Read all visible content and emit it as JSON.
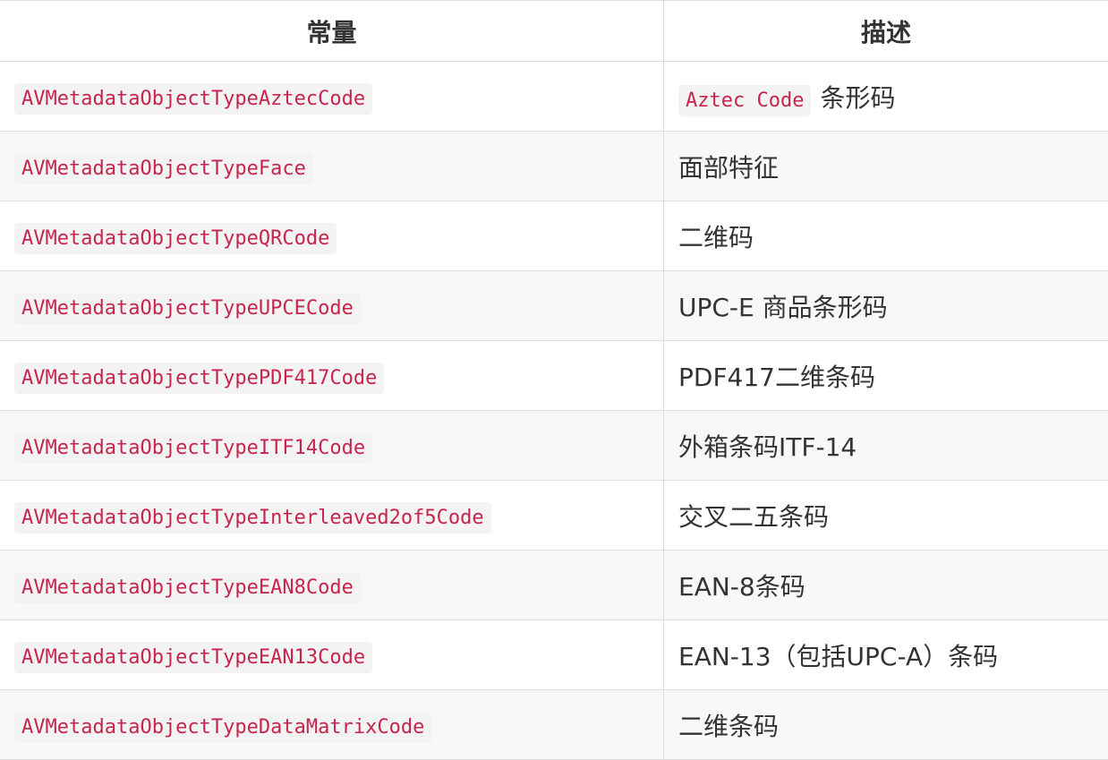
{
  "table": {
    "headers": [
      "常量",
      "描述"
    ],
    "rows": [
      {
        "constant": "AVMetadataObjectTypeAztecCode",
        "desc_code": "Aztec Code",
        "description": "条形码"
      },
      {
        "constant": "AVMetadataObjectTypeFace",
        "description": "面部特征"
      },
      {
        "constant": "AVMetadataObjectTypeQRCode",
        "description": "二维码"
      },
      {
        "constant": "AVMetadataObjectTypeUPCECode",
        "description": "UPC-E 商品条形码"
      },
      {
        "constant": "AVMetadataObjectTypePDF417Code",
        "description": "PDF417二维条码"
      },
      {
        "constant": "AVMetadataObjectTypeITF14Code",
        "description": "外箱条码ITF-14"
      },
      {
        "constant": "AVMetadataObjectTypeInterleaved2of5Code",
        "description": "交叉二五条码"
      },
      {
        "constant": "AVMetadataObjectTypeEAN8Code",
        "description": "EAN-8条码"
      },
      {
        "constant": "AVMetadataObjectTypeEAN13Code",
        "description": "EAN-13（包括UPC-A）条码"
      },
      {
        "constant": "AVMetadataObjectTypeDataMatrixCode",
        "description": "二维条码"
      }
    ]
  },
  "colors": {
    "code_text": "#c7254e",
    "code_background": "#f3f3f3",
    "row_alt_background": "#f8f8f8",
    "border": "#dcdcdc",
    "text": "#333333"
  }
}
